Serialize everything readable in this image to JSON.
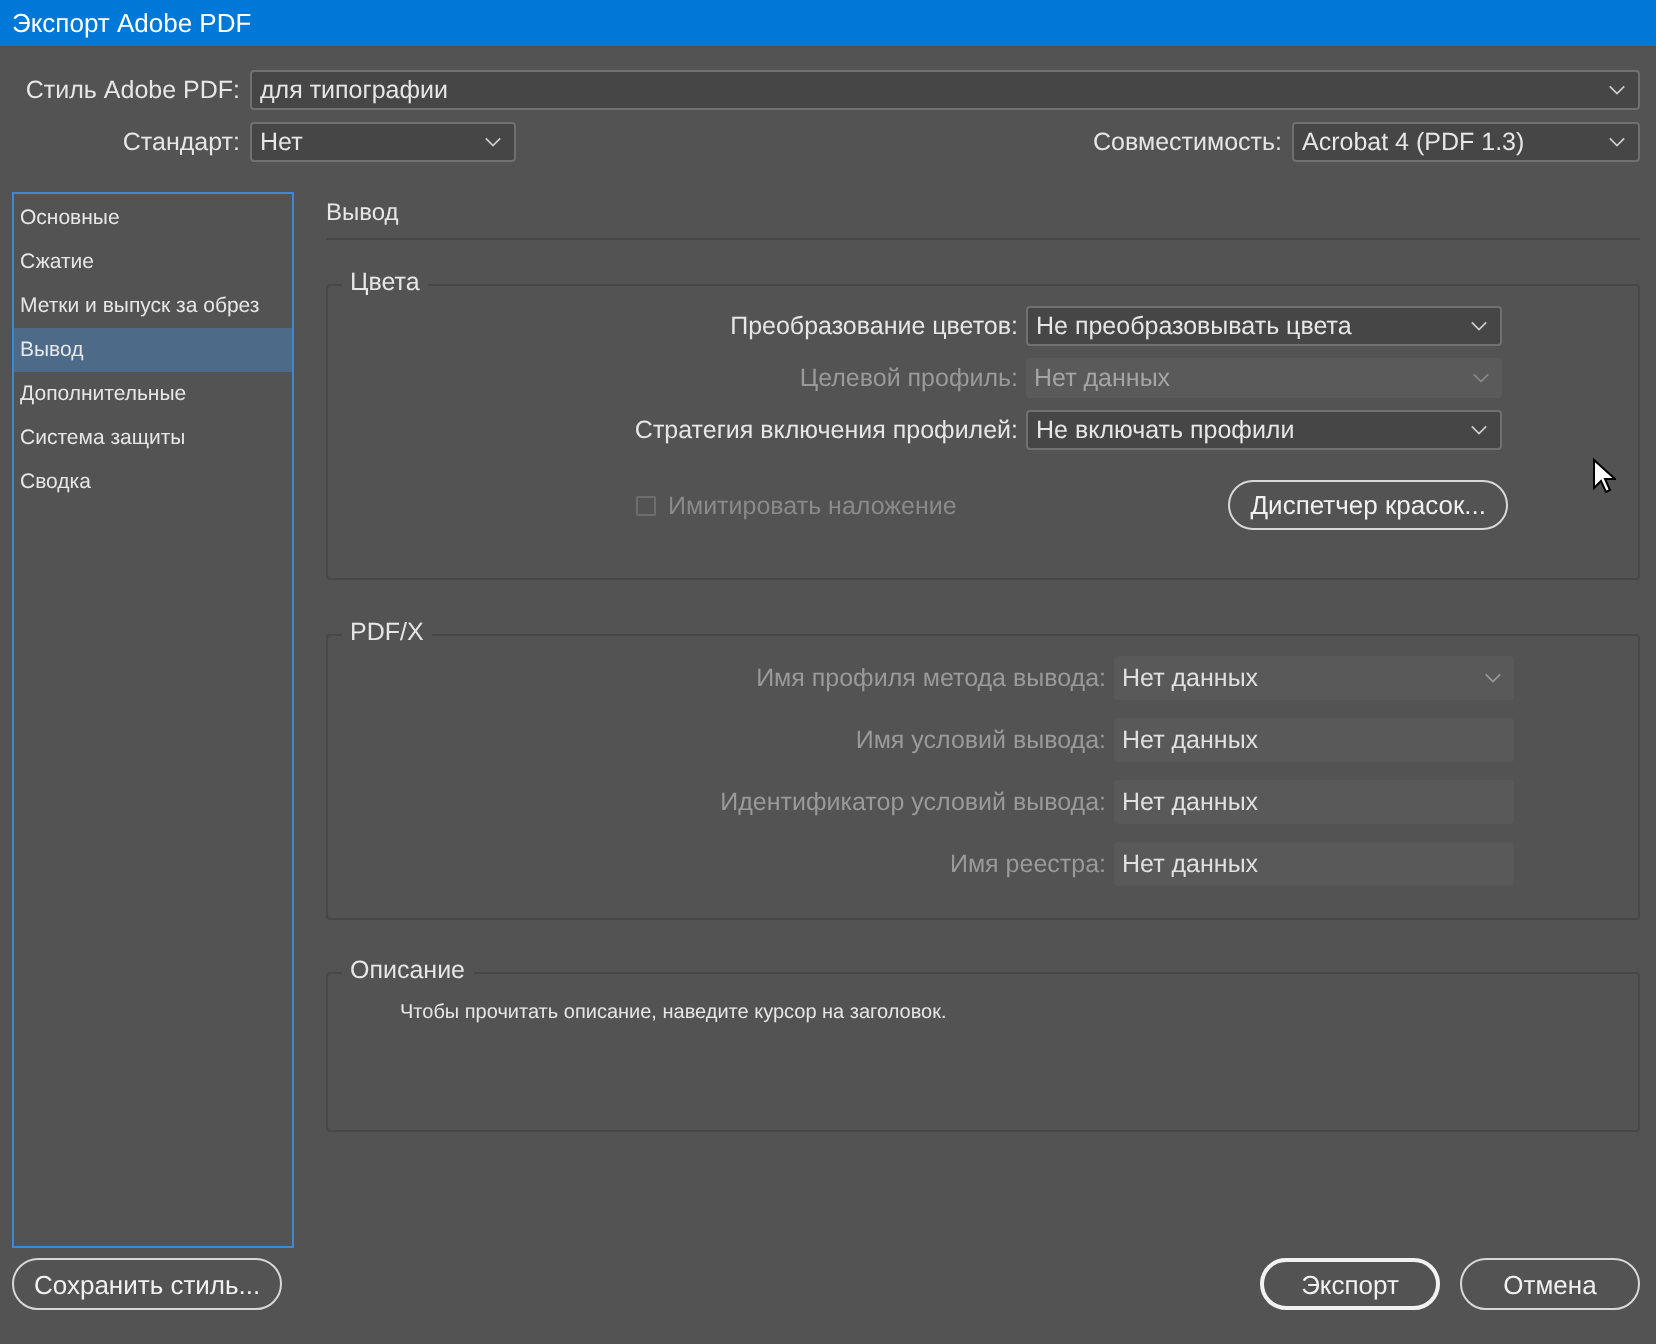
{
  "window": {
    "title": "Экспорт Adobe PDF"
  },
  "style": {
    "label": "Стиль Adobe PDF:",
    "value": "для типографии"
  },
  "standard": {
    "label": "Стандарт:",
    "value": "Нет"
  },
  "compatibility": {
    "label": "Совместимость:",
    "value": "Acrobat 4 (PDF 1.3)"
  },
  "sidebar": {
    "items": [
      {
        "label": "Основные",
        "selected": false
      },
      {
        "label": "Сжатие",
        "selected": false
      },
      {
        "label": "Метки и выпуск за обрез",
        "selected": false
      },
      {
        "label": "Вывод",
        "selected": true
      },
      {
        "label": "Дополнительные",
        "selected": false
      },
      {
        "label": "Система защиты",
        "selected": false
      },
      {
        "label": "Сводка",
        "selected": false
      }
    ]
  },
  "section_title": "Вывод",
  "colors": {
    "title": "Цвета",
    "fields": [
      {
        "label": "Преобразование цветов:",
        "value": "Не преобразовывать цвета",
        "kind": "dropdown",
        "disabled": false
      },
      {
        "label": "Целевой профиль:",
        "value": "Нет данных",
        "kind": "dropdown",
        "disabled": true
      },
      {
        "label": "Стратегия включения профилей:",
        "value": "Не включать профили",
        "kind": "dropdown",
        "disabled": false
      }
    ],
    "checkbox": {
      "label": "Имитировать наложение",
      "checked": false,
      "disabled": true
    },
    "button": "Диспетчер красок..."
  },
  "pdfx": {
    "title": "PDF/X",
    "fields": [
      {
        "label": "Имя профиля метода вывода:",
        "value": "Нет данных",
        "kind": "dropdown",
        "disabled": true
      },
      {
        "label": "Имя условий вывода:",
        "value": "Нет данных",
        "kind": "text",
        "disabled": true
      },
      {
        "label": "Идентификатор условий вывода:",
        "value": "Нет данных",
        "kind": "text",
        "disabled": true
      },
      {
        "label": "Имя реестра:",
        "value": "Нет данных",
        "kind": "text",
        "disabled": true
      }
    ]
  },
  "description": {
    "title": "Описание",
    "text": "Чтобы прочитать описание, наведите курсор на заголовок."
  },
  "save_button": {
    "label": "Сохранить стиль...",
    "default": false
  },
  "buttons": [
    {
      "label": "Экспорт",
      "default": true
    },
    {
      "label": "Отмена",
      "default": false
    }
  ]
}
